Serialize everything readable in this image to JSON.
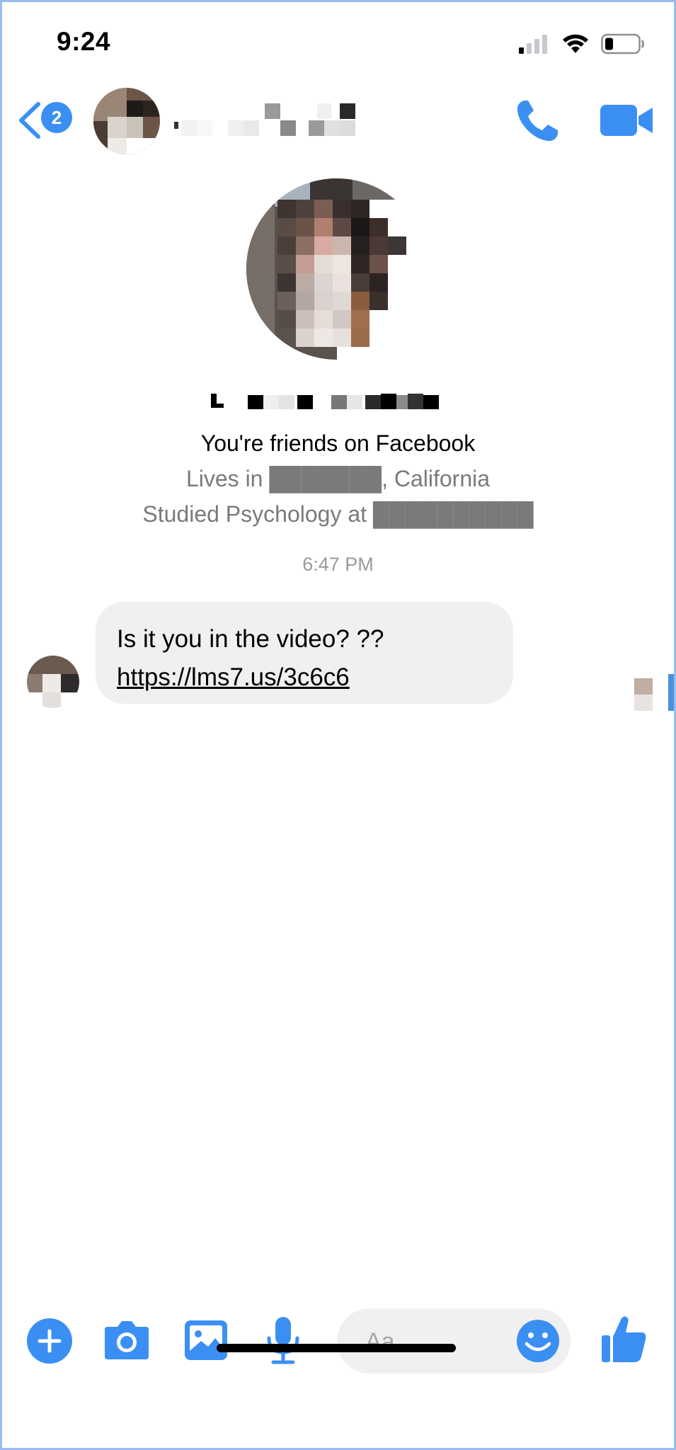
{
  "status": {
    "time": "9:24"
  },
  "header": {
    "unread_count": "2"
  },
  "profile": {
    "friends_text": "You're friends on Facebook",
    "lives_text": "Lives in ███████, California",
    "studied_text": "Studied Psychology at ██████████"
  },
  "conversation": {
    "timestamp": "6:47 PM",
    "message": {
      "text": "Is it you in the video? ??",
      "link": "https://lms7.us/3c6c6"
    }
  },
  "composer": {
    "placeholder": "Aa"
  },
  "colors": {
    "accent": "#3b8ff3",
    "bubble": "#f0f0f0",
    "frame": "#9bbcf0"
  }
}
